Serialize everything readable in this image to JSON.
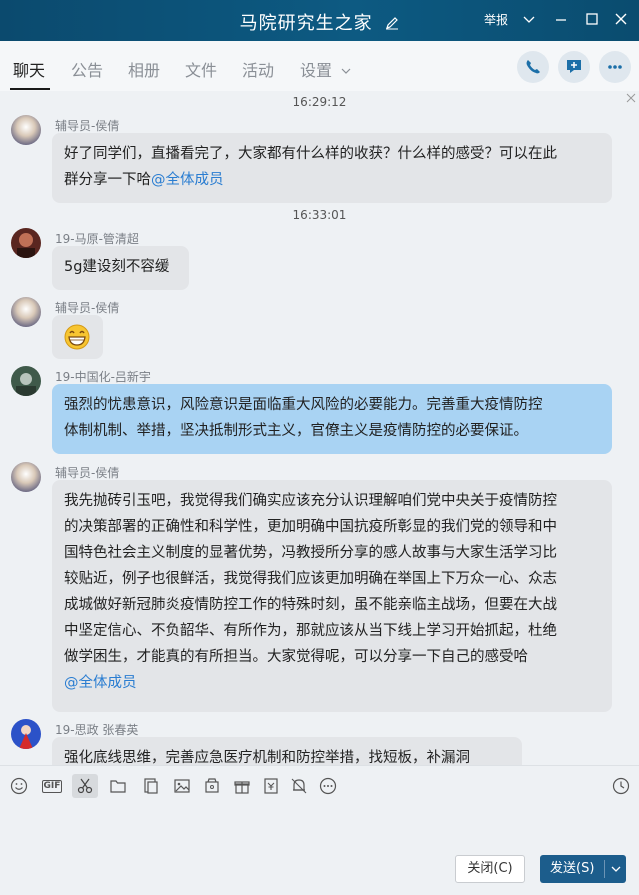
{
  "window": {
    "title": "马院研究生之家",
    "report_label": "举报"
  },
  "tabs": [
    {
      "label": "聊天",
      "active": true
    },
    {
      "label": "公告"
    },
    {
      "label": "相册"
    },
    {
      "label": "文件"
    },
    {
      "label": "活动"
    },
    {
      "label": "设置"
    }
  ],
  "messages": {
    "timestamps": [
      "16:29:12",
      "16:33:01"
    ],
    "items": [
      {
        "sender": "辅导员-侯倩",
        "lines": [
          "好了同学们，直播看完了，大家都有什么样的收获？什么样的感受？可以在此",
          "群分享一下哈"
        ],
        "mention": "@全体成员"
      },
      {
        "sender": "19-马原-管清超",
        "lines": [
          "5g建设刻不容缓"
        ]
      },
      {
        "sender": "辅导员-侯倩",
        "emoji": "grin-emoji"
      },
      {
        "sender": "19-中国化-吕新宇",
        "lines": [
          "强烈的忧患意识，风险意识是面临重大风险的必要能力。完善重大疫情防控",
          "体制机制、举措，坚决抵制形式主义，官僚主义是疫情防控的必要保证。"
        ]
      },
      {
        "sender": "辅导员-侯倩",
        "lines": [
          "我先抛砖引玉吧，我觉得我们确实应该充分认识理解咱们党中央关于疫情防控",
          "的决策部署的正确性和科学性，更加明确中国抗疫所彰显的我们党的领导和中",
          "国特色社会主义制度的显著优势，冯教授所分享的感人故事与大家生活学习比",
          "较贴近，例子也很鲜活，我觉得我们应该更加明确在举国上下万众一心、众志",
          "成城做好新冠肺炎疫情防控工作的特殊时刻，虽不能亲临主战场，但要在大战",
          "中坚定信心、不负韶华、有所作为，那就应该从当下线上学习开始抓起，杜绝",
          "做学困生，才能真的有所担当。大家觉得呢，可以分享一下自己的感受哈"
        ],
        "mention": "@全体成员"
      },
      {
        "sender": "19-思政 张春英",
        "lines": [
          "强化底线思维，完善应急医疗机制和防控举措，找短板，补漏洞"
        ]
      }
    ]
  },
  "buttons": {
    "close_label": "关闭(C)",
    "send_label": "发送(S)"
  },
  "toolbar": {
    "gif_label": "GIF"
  },
  "colors": {
    "titlebar": "#0d5a82",
    "send_button": "#1c5d8c",
    "highlight_bubble": "#a9d3f3",
    "mention": "#2a7dd1"
  }
}
